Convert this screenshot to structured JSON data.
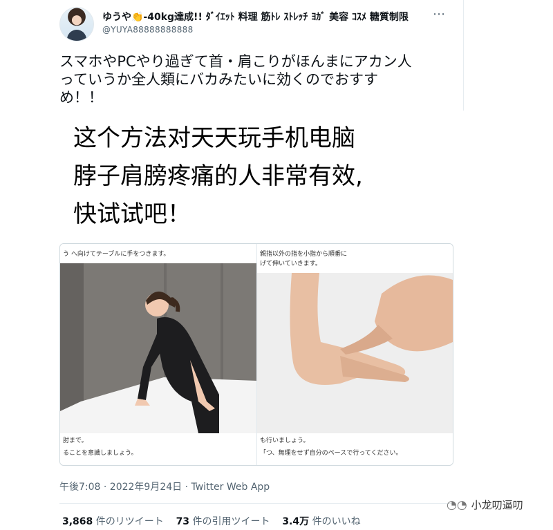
{
  "header": {
    "display_name": "ゆうや👏-40kg達成!! ﾀﾞｲｴｯﾄ 料理 筋ﾄﾚ ｽﾄﾚｯﾁ ﾖｶﾞ 美容 ｺｽﾒ 糖質制限",
    "handle": "@YUYA88888888888",
    "more_label": "⋯"
  },
  "tweet": {
    "lines": [
      "スマホやPCやり過ぎて首・肩こりがほんまにアカン人",
      "っていうか全人類にバカみたいに効くのでおすす",
      "め！！"
    ]
  },
  "overlay_caption": {
    "lines": [
      "这个方法对天天玩手机电脑",
      "脖子肩膀疼痛的人非常有效,",
      "快试试吧！"
    ]
  },
  "media": {
    "left": {
      "top_text": "う へ向けてテーブルに手をつきます。",
      "bottom_text_1": "肘まで。",
      "bottom_text_2": "ることを意識しましょう。"
    },
    "right": {
      "top_text_1": "親指以外の指を小指から順番に",
      "top_text_2": "げて伸いていきます。",
      "bottom_text_1": "も行いましょう。",
      "bottom_text_2": "「つ、無理をせず自分のペースで行ってください。"
    }
  },
  "footer": {
    "timestamp": "午後7:08 · 2022年9月24日 · Twitter Web App"
  },
  "stats": {
    "retweets_count": "3,868",
    "retweets_label": " 件のリツイート",
    "quotes_count": "73",
    "quotes_label": " 件の引用ツイート",
    "likes_count": "3.4万",
    "likes_label": " 件のいいね"
  },
  "watermark": {
    "icon": "wechat-icon",
    "text": "小龙叨逼叨"
  }
}
